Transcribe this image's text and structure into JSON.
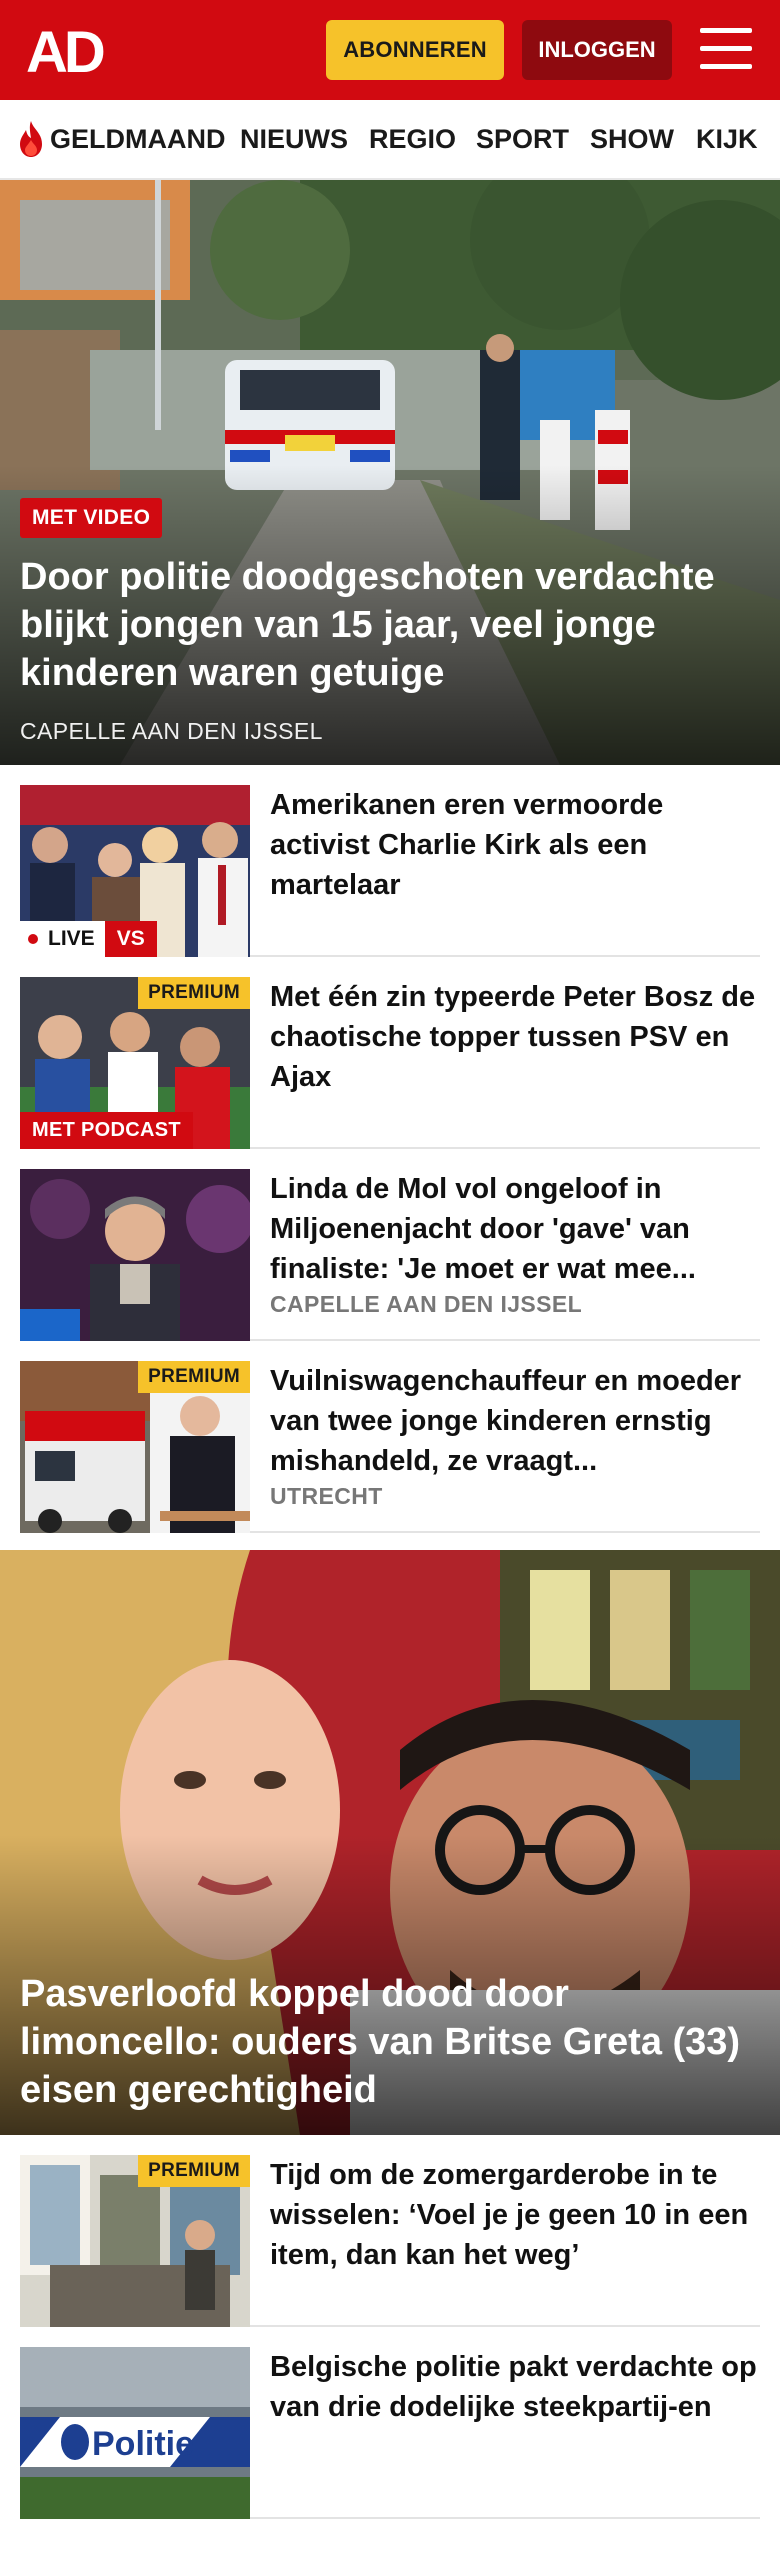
{
  "header": {
    "logo_text": "AD",
    "subscribe_label": "ABONNEREN",
    "login_label": "INLOGGEN",
    "colors": {
      "brand_red": "#d10a11",
      "accent_yellow": "#f6c22a"
    }
  },
  "nav": {
    "items": [
      "GELDMAAND",
      "NIEUWS",
      "REGIO",
      "SPORT",
      "SHOW",
      "KIJK"
    ]
  },
  "hero": {
    "badge": "MET VIDEO",
    "title": "Door politie doodgeschoten verdachte blijkt jongen van 15 jaar, veel jonge kinderen waren getuige",
    "location": "CAPELLE AAN DEN IJSSEL"
  },
  "articles": [
    {
      "title": "Amerikanen eren vermoorde activist Charlie Kirk als een martelaar",
      "live": "LIVE",
      "vs": "VS"
    },
    {
      "title": "Met één zin typeerde Peter Bosz de chaotische topper tussen PSV en Ajax",
      "premium": "PREMIUM",
      "podcast": "MET PODCAST"
    },
    {
      "title": "Linda de Mol vol ongeloof in Miljoenenjacht door 'gave' van finaliste: 'Je moet er wat mee...",
      "location": "CAPELLE AAN DEN IJSSEL"
    },
    {
      "title": "Vuilniswagenchauffeur en moeder van twee jonge kinderen ernstig mishandeld, ze vraagt...",
      "premium": "PREMIUM",
      "location": "UTRECHT"
    }
  ],
  "hero2": {
    "title": "Pasverloofd koppel dood door limoncello: ouders van Britse Greta (33) eisen gerechtigheid"
  },
  "articles2": [
    {
      "title": "Tijd om de zomergarderobe in te wisselen: ‘Voel je je geen 10 in een item, dan kan het weg’",
      "premium": "PREMIUM"
    },
    {
      "title": "Belgische politie pakt verdachte op van drie dodelijke steekpartij-en",
      "thumb_text": "Politie"
    }
  ]
}
